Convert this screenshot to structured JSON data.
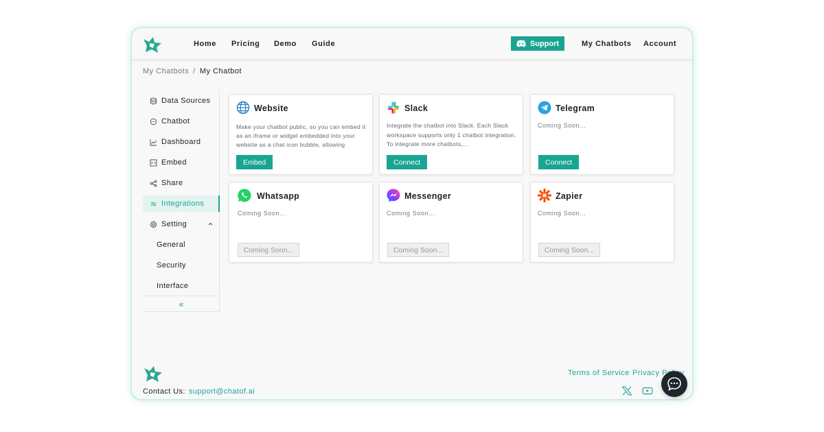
{
  "nav": {
    "links": [
      "Home",
      "Pricing",
      "Demo",
      "Guide"
    ],
    "support_label": "Support",
    "right_links": [
      "My Chatbots",
      "Account"
    ]
  },
  "breadcrumb": {
    "parent": "My Chatbots",
    "separator": "/",
    "current": "My Chatbot"
  },
  "sidebar": {
    "items": [
      {
        "label": "Data Sources",
        "icon": "database-icon"
      },
      {
        "label": "Chatbot",
        "icon": "chat-icon"
      },
      {
        "label": "Dashboard",
        "icon": "chart-line-icon"
      },
      {
        "label": "Embed",
        "icon": "embed-icon"
      },
      {
        "label": "Share",
        "icon": "share-icon"
      },
      {
        "label": "Integrations",
        "icon": "integrations-icon",
        "active": true
      },
      {
        "label": "Setting",
        "icon": "gear-icon",
        "expanded": true
      }
    ],
    "sub_items": [
      "General",
      "Security",
      "Interface"
    ],
    "collapse_label": "«"
  },
  "integrations": [
    {
      "name": "Website",
      "icon": "globe-icon",
      "description": "Make your chatbot public, so you can embed it as an iframe or widget embedded into your website as a chat icon bubble, allowing users...",
      "button": "Embed",
      "button_enabled": true
    },
    {
      "name": "Slack",
      "icon": "slack-icon",
      "description": "Integrate the chatbot into Slack. Each Slack workspace supports only 1 chatbot integration. To integrate more chatbots,...",
      "button": "Connect",
      "button_enabled": true
    },
    {
      "name": "Telegram",
      "icon": "telegram-icon",
      "status": "Coming Soon...",
      "button": "Connect",
      "button_enabled": true
    },
    {
      "name": "Whatsapp",
      "icon": "whatsapp-icon",
      "status": "Coming Soon...",
      "button": "Coming Soon...",
      "button_enabled": false
    },
    {
      "name": "Messenger",
      "icon": "messenger-icon",
      "status": "Coming Soon...",
      "button": "Coming Soon...",
      "button_enabled": false
    },
    {
      "name": "Zapier",
      "icon": "zapier-icon",
      "status": "Coming Soon...",
      "button": "Coming Soon...",
      "button_enabled": false
    }
  ],
  "footer": {
    "contact_label": "Contact Us:",
    "contact_email": "support@chatof.ai",
    "links": [
      "Terms of Service",
      "Privacy Policy"
    ],
    "social_icons": [
      "x-twitter-icon",
      "youtube-icon"
    ]
  },
  "colors": {
    "accent": "#1aa592",
    "frame_border": "#c9efe4",
    "active_bg": "#e3f4ef",
    "chat_bubble": "#1f252c"
  }
}
